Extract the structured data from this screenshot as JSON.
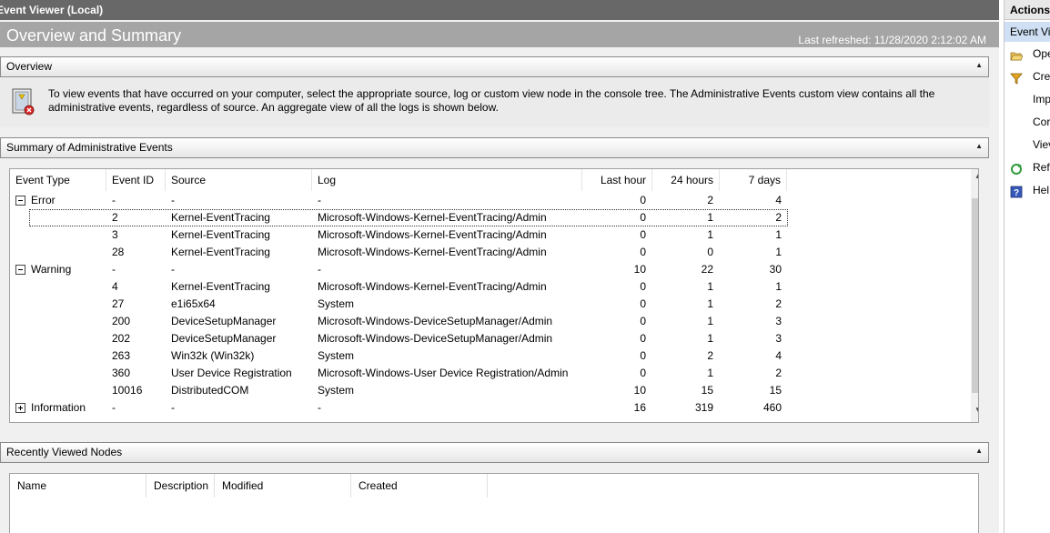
{
  "window": {
    "title": "Event Viewer (Local)"
  },
  "header": {
    "title": "Overview and Summary",
    "last_refreshed": "Last refreshed: 11/28/2020 2:12:02 AM"
  },
  "overview": {
    "label": "Overview",
    "text": "To view events that have occurred on your computer, select the appropriate source, log or custom view node in the console tree. The Administrative Events custom view contains all the administrative events, regardless of source. An aggregate view of all the logs is shown below."
  },
  "summary": {
    "label": "Summary of Administrative Events",
    "columns": [
      "Event Type",
      "Event ID",
      "Source",
      "Log",
      "Last hour",
      "24 hours",
      "7 days"
    ],
    "rows": [
      {
        "type": "Error",
        "group": true,
        "expanded": true,
        "id": "-",
        "source": "-",
        "log": "-",
        "hour": "0",
        "day": "2",
        "week": "4"
      },
      {
        "type": "",
        "id": "2",
        "source": "Kernel-EventTracing",
        "log": "Microsoft-Windows-Kernel-EventTracing/Admin",
        "hour": "0",
        "day": "1",
        "week": "2",
        "selected": true
      },
      {
        "type": "",
        "id": "3",
        "source": "Kernel-EventTracing",
        "log": "Microsoft-Windows-Kernel-EventTracing/Admin",
        "hour": "0",
        "day": "1",
        "week": "1"
      },
      {
        "type": "",
        "id": "28",
        "source": "Kernel-EventTracing",
        "log": "Microsoft-Windows-Kernel-EventTracing/Admin",
        "hour": "0",
        "day": "0",
        "week": "1"
      },
      {
        "type": "Warning",
        "group": true,
        "expanded": true,
        "id": "-",
        "source": "-",
        "log": "-",
        "hour": "10",
        "day": "22",
        "week": "30"
      },
      {
        "type": "",
        "id": "4",
        "source": "Kernel-EventTracing",
        "log": "Microsoft-Windows-Kernel-EventTracing/Admin",
        "hour": "0",
        "day": "1",
        "week": "1"
      },
      {
        "type": "",
        "id": "27",
        "source": "e1i65x64",
        "log": "System",
        "hour": "0",
        "day": "1",
        "week": "2"
      },
      {
        "type": "",
        "id": "200",
        "source": "DeviceSetupManager",
        "log": "Microsoft-Windows-DeviceSetupManager/Admin",
        "hour": "0",
        "day": "1",
        "week": "3"
      },
      {
        "type": "",
        "id": "202",
        "source": "DeviceSetupManager",
        "log": "Microsoft-Windows-DeviceSetupManager/Admin",
        "hour": "0",
        "day": "1",
        "week": "3"
      },
      {
        "type": "",
        "id": "263",
        "source": "Win32k (Win32k)",
        "log": "System",
        "hour": "0",
        "day": "2",
        "week": "4"
      },
      {
        "type": "",
        "id": "360",
        "source": "User Device Registration",
        "log": "Microsoft-Windows-User Device Registration/Admin",
        "hour": "0",
        "day": "1",
        "week": "2"
      },
      {
        "type": "",
        "id": "10016",
        "source": "DistributedCOM",
        "log": "System",
        "hour": "10",
        "day": "15",
        "week": "15"
      },
      {
        "type": "Information",
        "group": true,
        "expanded": false,
        "id": "-",
        "source": "-",
        "log": "-",
        "hour": "16",
        "day": "319",
        "week": "460"
      }
    ]
  },
  "recent": {
    "label": "Recently Viewed Nodes",
    "columns": [
      "Name",
      "Description",
      "Modified",
      "Created"
    ]
  },
  "actions": {
    "title": "Actions",
    "subtitle": "Event Vi",
    "items": [
      {
        "label": "Ope",
        "icon": "folder-open-icon"
      },
      {
        "label": "Cre",
        "icon": "filter-icon"
      },
      {
        "label": "Imp",
        "icon": ""
      },
      {
        "label": "Cor",
        "icon": ""
      },
      {
        "label": "Viev",
        "icon": ""
      },
      {
        "label": "Refr",
        "icon": "refresh-icon"
      },
      {
        "label": "Hel",
        "icon": "help-icon"
      }
    ]
  },
  "colors": {
    "title_bar": "#686868",
    "header": "#a5a5a5",
    "selection_highlight": "#cfe0f4"
  }
}
